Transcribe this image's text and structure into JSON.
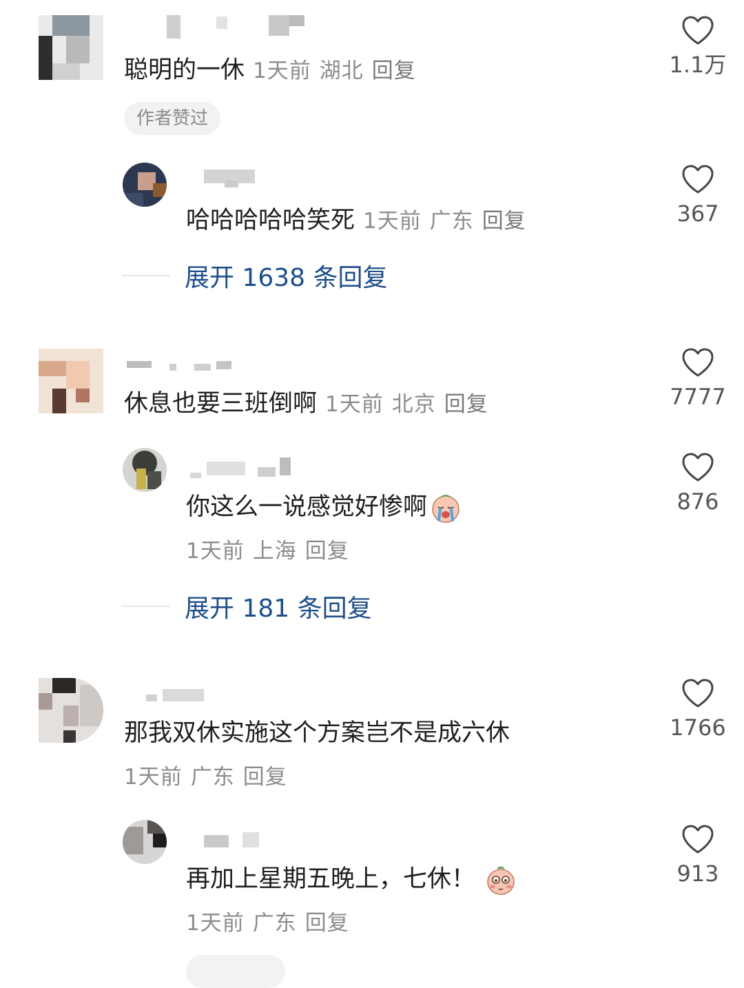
{
  "comments": [
    {
      "text": "聪明的一休",
      "time": "1天前",
      "location": "湖北",
      "reply_label": "回复",
      "likes": "1.1万",
      "badge": "作者赞过",
      "replies": [
        {
          "text": "哈哈哈哈哈笑死",
          "time": "1天前",
          "location": "广东",
          "reply_label": "回复",
          "likes": "367"
        }
      ],
      "expand_label": "展开 1638 条回复"
    },
    {
      "text": "休息也要三班倒啊",
      "time": "1天前",
      "location": "北京",
      "reply_label": "回复",
      "likes": "7777",
      "replies": [
        {
          "text": "你这么一说感觉好惨啊",
          "emoji": "crying-face",
          "time": "1天前",
          "location": "上海",
          "reply_label": "回复",
          "likes": "876"
        }
      ],
      "expand_label": "展开 181 条回复"
    },
    {
      "text": "那我双休实施这个方案岂不是成六休",
      "time": "1天前",
      "location": "广东",
      "reply_label": "回复",
      "likes": "1766",
      "replies": [
        {
          "text": "再加上星期五晚上，七休！",
          "emoji": "shy-face",
          "time": "1天前",
          "location": "广东",
          "reply_label": "回复",
          "likes": "913"
        }
      ]
    }
  ],
  "colors": {
    "expand_link": "#1d4e89",
    "meta_text": "#8c8c8c",
    "heart_stroke": "#444444"
  }
}
